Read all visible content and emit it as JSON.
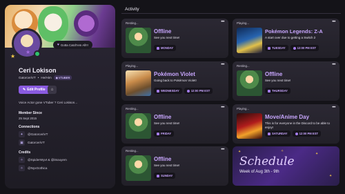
{
  "profile": {
    "status": "Gotta Catch'em All!!!",
    "name": "Ceri Lokison",
    "handle": "GatorceriVT",
    "pronouns": "He/Him",
    "tag": "VTUBER",
    "edit_label": "Edit Profile",
    "bio": "Voice Actor gone VTuber ? Ceri Lokison...",
    "member_since_label": "Member Since",
    "member_since": "25 Sept 2015",
    "connections_label": "Connections",
    "connections": [
      "@GatorceriVT",
      "GatorceriVT"
    ],
    "credits_label": "Credits",
    "credits": [
      "@SpiderWyvt & @itsouyem",
      "@NyxGothica"
    ]
  },
  "activity": {
    "title": "Activity",
    "cards": [
      {
        "state": "Resting...",
        "title": "Offline",
        "subtitle": "See you next time!",
        "day": "MONDAY",
        "time": ""
      },
      {
        "state": "Playing...",
        "title": "Pokémon Legends: Z-A",
        "subtitle": "A start over due to getting a Switch 2",
        "day": "TUESDAY",
        "time": "12:00 PM EST"
      },
      {
        "state": "Playing...",
        "title": "Pokémon Violet",
        "subtitle": "Going back to Pokémon Violet!",
        "day": "WEDNESDAY",
        "time": "12:00 PM EST"
      },
      {
        "state": "Resting...",
        "title": "Offline",
        "subtitle": "See you next time!",
        "day": "THURSDAY",
        "time": ""
      },
      {
        "state": "Resting...",
        "title": "Offline",
        "subtitle": "See you next time!",
        "day": "FRIDAY",
        "time": ""
      },
      {
        "state": "Playing...",
        "title": "Move/Anime Day",
        "subtitle": "This is for everyone in the Discord to be able to enjoy!",
        "day": "SATURDAY",
        "time": "12:00 PM EST"
      },
      {
        "state": "Resting...",
        "title": "Offline",
        "subtitle": "See you next time!",
        "day": "SUNDAY",
        "time": ""
      }
    ],
    "more_icon": "•••"
  },
  "schedule": {
    "title": "Schedule",
    "subtitle": "Week of Aug 3th - 9th"
  },
  "colors": {
    "accent": "#c9a7ff",
    "button": "#8a5be0",
    "background": "#141318",
    "card": "#2b2833"
  }
}
